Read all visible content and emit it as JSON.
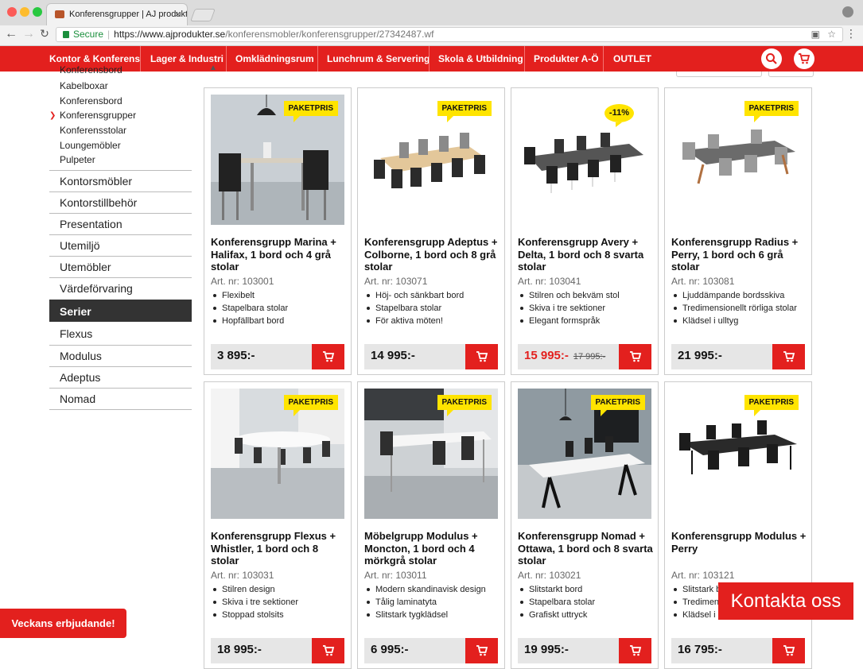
{
  "browser": {
    "tab_title": "Konferensgrupper | AJ produkter",
    "close_glyph": "×",
    "secure_label": "Secure",
    "url_host": "https://www.ajprodukter.se",
    "url_path": "/konferensmobler/konferensgrupper/27342487.wf"
  },
  "topnav": {
    "items": [
      "Kontor & Konferens",
      "Lager & Industri",
      "Omklädningsrum",
      "Lunchrum & Servering",
      "Skola & Utbildning",
      "Produkter A-Ö",
      "OUTLET"
    ]
  },
  "sidebar": {
    "subitems": [
      "Konferensbord",
      "Kabelboxar",
      "Konferensbord",
      "Konferensgrupper",
      "Konferensstolar",
      "Loungemöbler",
      "Pulpeter"
    ],
    "active_subitem_index": 3,
    "categories": [
      "Kontorsmöbler",
      "Kontorstillbehör",
      "Presentation",
      "Utemiljö",
      "Utemöbler",
      "Värdeförvaring",
      "Serier",
      "Flexus",
      "Modulus",
      "Adeptus",
      "Nomad"
    ],
    "active_category_index": 6
  },
  "products": [
    {
      "title": "Konferensgrupp Marina + Halifax, 1 bord och 4 grå stolar",
      "art": "Art. nr: 103001",
      "badge": "PAKETPRIS",
      "features": [
        "Flexibelt",
        "Stapelbara stolar",
        "Hopfällbart bord"
      ],
      "price": "3 895:-",
      "old_price": ""
    },
    {
      "title": "Konferensgrupp Adeptus + Colborne, 1 bord och 8 grå stolar",
      "art": "Art. nr: 103071",
      "badge": "PAKETPRIS",
      "features": [
        "Höj- och sänkbart bord",
        "Stapelbara stolar",
        "För aktiva möten!"
      ],
      "price": "14 995:-",
      "old_price": ""
    },
    {
      "title": "Konferensgrupp Avery + Delta, 1 bord och 8 svarta stolar",
      "art": "Art. nr: 103041",
      "badge": "-11%",
      "features": [
        "Stilren och bekväm stol",
        "Skiva i tre sektioner",
        "Elegant formspråk"
      ],
      "price": "15 995:-",
      "old_price": "17 995:-"
    },
    {
      "title": "Konferensgrupp Radius + Perry, 1 bord och 6 grå stolar",
      "art": "Art. nr: 103081",
      "badge": "PAKETPRIS",
      "features": [
        "Ljuddämpande bordsskiva",
        "Tredimensionellt rörliga stolar",
        "Klädsel i ulltyg"
      ],
      "price": "21 995:-",
      "old_price": ""
    },
    {
      "title": "Konferensgrupp Flexus + Whistler, 1 bord och 8 stolar",
      "art": "Art. nr: 103031",
      "badge": "PAKETPRIS",
      "features": [
        "Stilren design",
        "Skiva i tre sektioner",
        "Stoppad stolsits"
      ],
      "price": "18 995:-",
      "old_price": ""
    },
    {
      "title": "Möbelgrupp Modulus + Moncton, 1 bord och 4 mörkgrå stolar",
      "art": "Art. nr: 103011",
      "badge": "PAKETPRIS",
      "features": [
        "Modern skandinavisk design",
        "Tålig laminatyta",
        "Slitstark tygklädsel"
      ],
      "price": "6 995:-",
      "old_price": ""
    },
    {
      "title": "Konferensgrupp Nomad + Ottawa, 1 bord och 8 svarta stolar",
      "art": "Art. nr: 103021",
      "badge": "PAKETPRIS",
      "features": [
        "Slitstarkt bord",
        "Stapelbara stolar",
        "Grafiskt uttryck"
      ],
      "price": "19 995:-",
      "old_price": ""
    },
    {
      "title": "Konferensgrupp Modulus + Perry",
      "art": "Art. nr: 103121",
      "badge": "PAKETPRIS",
      "features": [
        "Slitstark bordsskiva",
        "Tredimensionellt rörliga stolar",
        "Klädsel i ulltyg"
      ],
      "price": "16 795:-",
      "old_price": ""
    }
  ],
  "promo_label": "Veckans erbjudande!",
  "contact_label": "Kontakta oss",
  "colors": {
    "brand_red": "#e3201e",
    "badge_yellow": "#ffe400",
    "active_dark": "#333333"
  }
}
